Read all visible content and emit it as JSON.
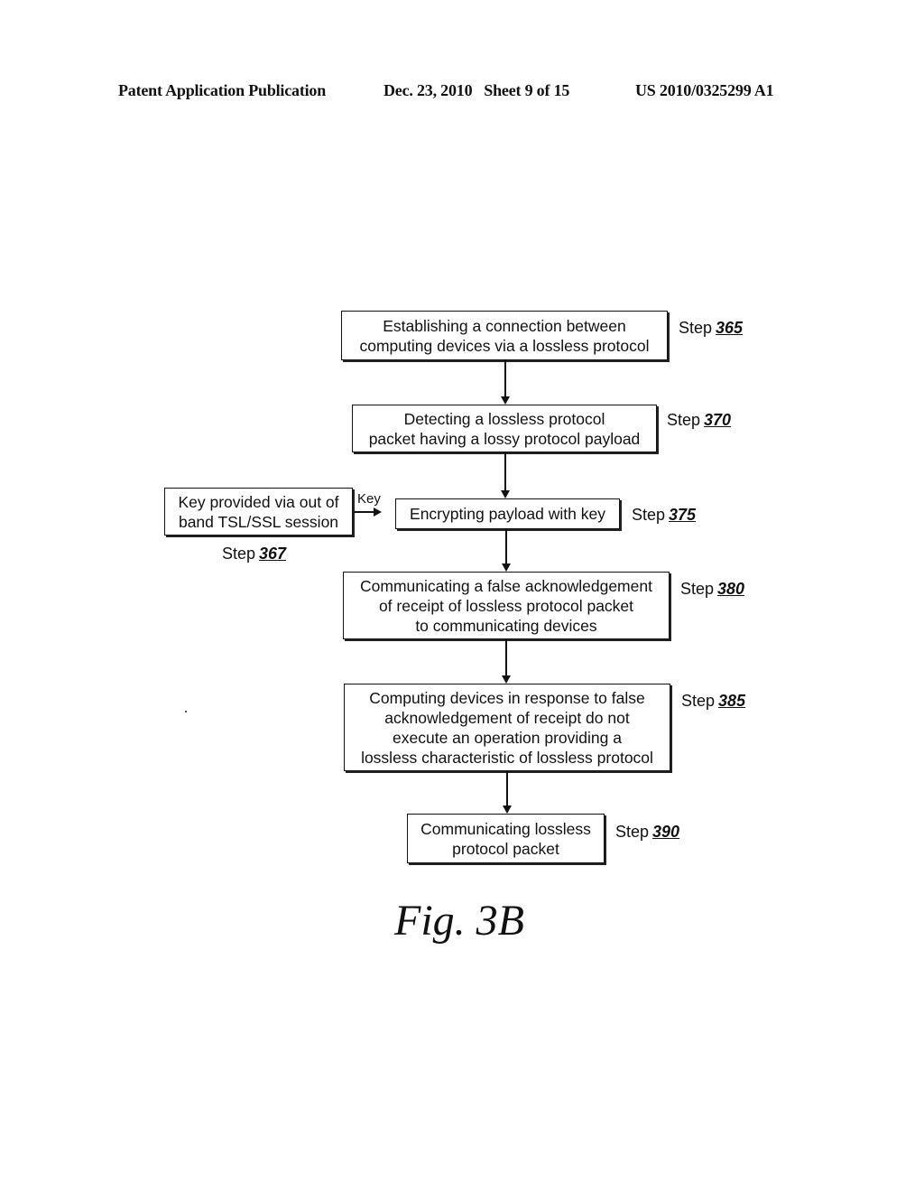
{
  "header": {
    "publication": "Patent Application Publication",
    "date_sheet": "Dec. 23, 2010   Sheet 9 of 15",
    "patent_number": "US 2010/0325299 A1"
  },
  "flowchart": {
    "steps": [
      {
        "id": "365",
        "prefix": "Step",
        "text": "Establishing a connection between\ncomputing devices via a lossless protocol"
      },
      {
        "id": "370",
        "prefix": "Step",
        "text": "Detecting a lossless protocol\npacket having a lossy protocol payload"
      },
      {
        "id": "367",
        "prefix": "Step",
        "text": "Key provided via out of\nband TSL/SSL session"
      },
      {
        "id": "375",
        "prefix": "Step",
        "text": "Encrypting payload with key"
      },
      {
        "id": "380",
        "prefix": "Step",
        "text": "Communicating a false acknowledgement\nof receipt of lossless protocol packet\nto communicating devices"
      },
      {
        "id": "385",
        "prefix": "Step",
        "text": "Computing devices in response to false\nacknowledgement of receipt do not\nexecute an operation providing a\nlossless characteristic of lossless protocol"
      },
      {
        "id": "390",
        "prefix": "Step",
        "text": "Communicating lossless\nprotocol packet"
      }
    ],
    "key_arrow_label": "Key"
  },
  "figure_label": "Fig. 3B"
}
